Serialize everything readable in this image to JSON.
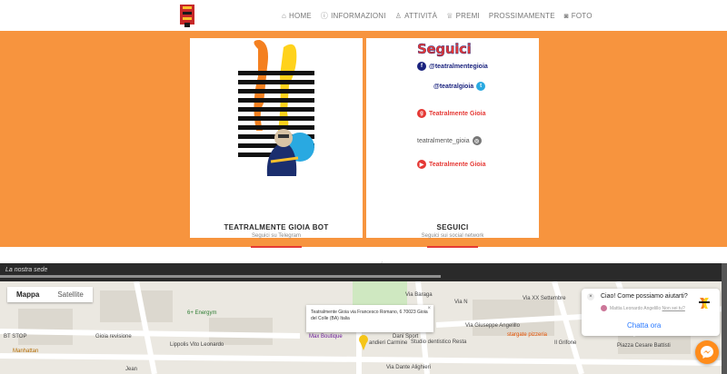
{
  "nav": {
    "items": [
      {
        "icon": "home-icon",
        "glyph": "⌂",
        "label": "HOME"
      },
      {
        "icon": "info-icon",
        "glyph": "ⓘ",
        "label": "INFORMAZIONI"
      },
      {
        "icon": "activity-icon",
        "glyph": "♙",
        "label": "ATTIVITÀ"
      },
      {
        "icon": "trophy-icon",
        "glyph": "♕",
        "label": "PREMI"
      },
      {
        "icon": "",
        "glyph": "",
        "label": "PROSSIMAMENTE"
      },
      {
        "icon": "camera-icon",
        "glyph": "◙",
        "label": "FOTO"
      }
    ]
  },
  "cards": {
    "bot": {
      "title": "TEATRALMENTE GIOIA BOT",
      "subtitle": "Seguici su Telegram"
    },
    "social": {
      "title": "SEGUICI",
      "subtitle": "Seguici sui social network"
    }
  },
  "follow": {
    "heading": "Seguici",
    "facebook": "@teatralmentegioia",
    "twitter": "@teatralgioia",
    "googleplus": "Teatralmente Gioia",
    "instagram": "teatralmente_gioia",
    "youtube": "Teatralmente Gioia"
  },
  "colors": {
    "band": "#f7943e",
    "accent": "#e53935",
    "chat_link": "#2979ff"
  },
  "strip": {
    "label": "La nostra sede"
  },
  "map": {
    "tabs": [
      "Mappa",
      "Satellite"
    ],
    "infowindow": "Teatralmente Gioia via Francesco Romano, 6 70023 Gioia del Colle (BA) Italia",
    "labels": {
      "energym": "6+ Energym",
      "bt_stop": "BT STOP",
      "manhattan": "Manhattan",
      "gioia_revisione": "Gioia revisione",
      "lippolis": "Lippolis Vito Leonardo",
      "jean": "Jean",
      "max_boutique": "Max Boutique",
      "dani_sport": "Dani Sport",
      "candieri": "andieri Carmine",
      "dentistico": "Studio dentistico Resta",
      "stargate": "stargate pizzeria",
      "grifone": "Il Grifone",
      "piazza": "Piazza Cesare Battisti",
      "via_dante": "Via Dante Alighieri",
      "via_giuseppe": "Via Giuseppe Angelillo",
      "via_settembre": "Via XX Settembre",
      "via_nerso": "Via N",
      "via_bar": "Via Baraga"
    }
  },
  "chat": {
    "message": "Ciao! Come possiamo aiutarti?",
    "meta": "Mattia Leonardo Angelillo",
    "meta_link": "Non sei tu?",
    "button": "Chatta ora"
  }
}
